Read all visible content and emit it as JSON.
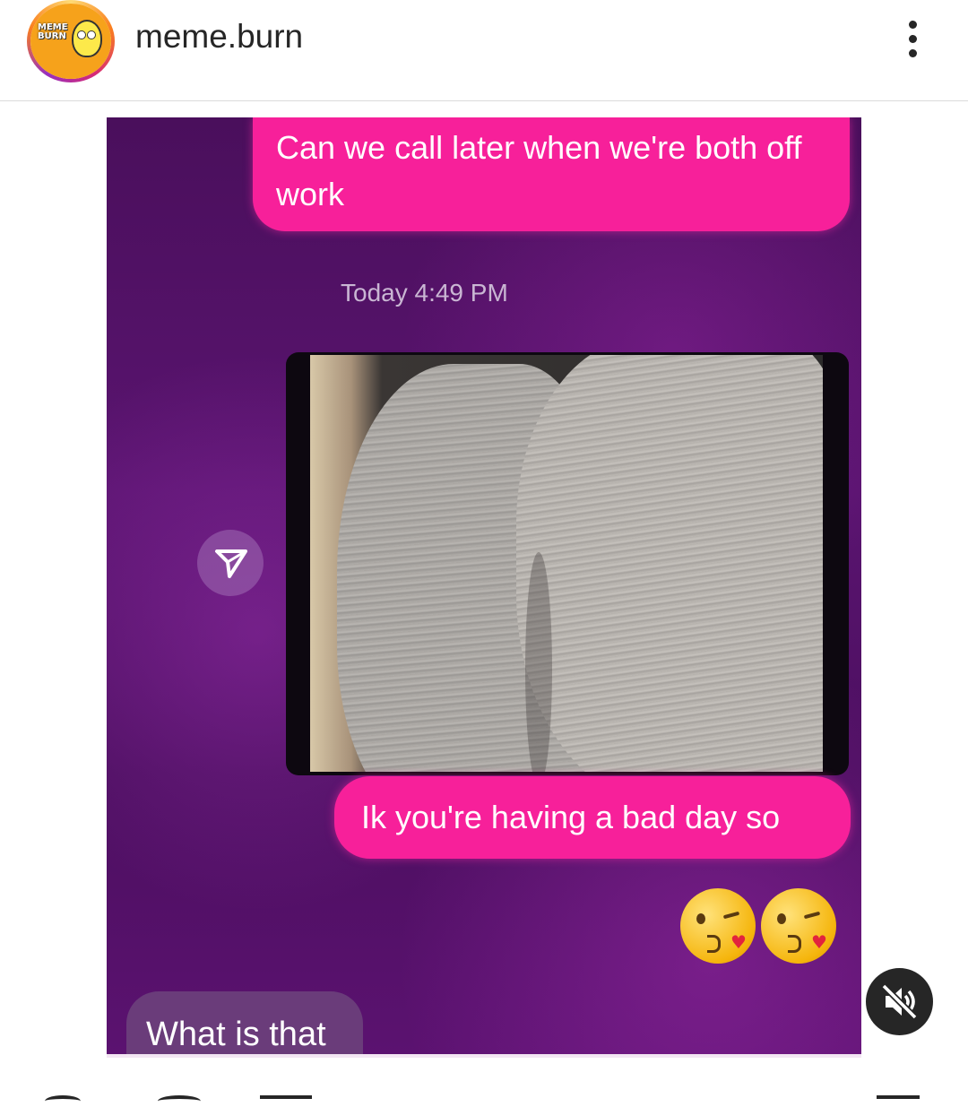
{
  "header": {
    "username": "meme.burn",
    "avatar_text": "MEME BURN",
    "more_icon": "more-vertical-icon"
  },
  "post": {
    "messages": [
      {
        "direction": "outgoing",
        "text": "Can we call later when we're both off work"
      },
      {
        "direction": "timestamp",
        "text": "Today 4:49 PM"
      },
      {
        "direction": "outgoing",
        "type": "image"
      },
      {
        "direction": "outgoing",
        "text": "Ik you're having a bad day so"
      },
      {
        "direction": "outgoing",
        "type": "emoji",
        "text": "😘😘"
      },
      {
        "direction": "incoming",
        "text": "What is that"
      }
    ],
    "share_icon": "share-arrow-icon",
    "mute_icon": "speaker-muted-icon"
  },
  "colors": {
    "bubble_outgoing": "#f7209a",
    "bubble_incoming": "#6a3c7a",
    "chat_background": "#4a0f5c"
  }
}
